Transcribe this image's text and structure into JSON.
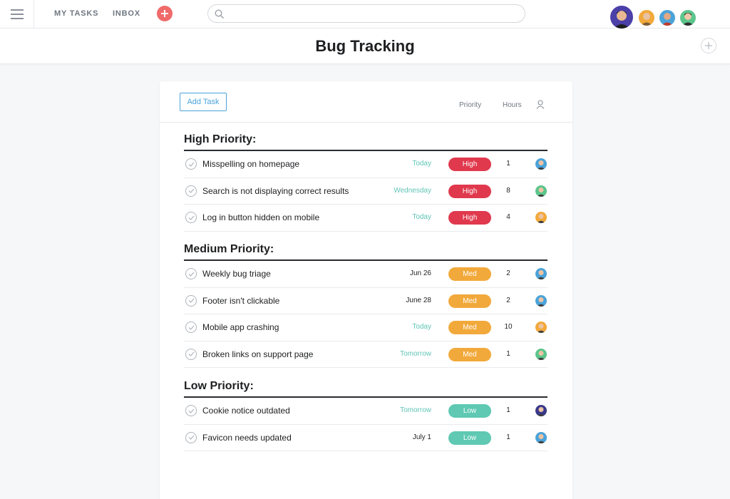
{
  "nav": {
    "my_tasks": "MY TASKS",
    "inbox": "INBOX",
    "search_placeholder": ""
  },
  "project": {
    "title": "Bug Tracking"
  },
  "toolbar": {
    "add_task_label": "Add Task",
    "priority_header": "Priority",
    "hours_header": "Hours"
  },
  "colors": {
    "high": "#e0394d",
    "med": "#f2a93b",
    "low": "#5fc9b3",
    "accent": "#4ba3d9",
    "due_teal": "#5fc4b6"
  },
  "sections": [
    {
      "title": "High Priority:",
      "tasks": [
        {
          "name": "Misspelling on homepage",
          "due": "Today",
          "priority": "High",
          "hours": "1",
          "assignee_icon": "avatar-icon"
        },
        {
          "name": "Search is not displaying correct results",
          "due": "Wednesday",
          "priority": "High",
          "hours": "8",
          "assignee_icon": "avatar-icon"
        },
        {
          "name": "Log in button hidden on mobile",
          "due": "Today",
          "priority": "High",
          "hours": "4",
          "assignee_icon": "avatar-icon"
        }
      ]
    },
    {
      "title": "Medium Priority:",
      "tasks": [
        {
          "name": "Weekly bug triage",
          "due": "Jun 26",
          "priority": "Med",
          "hours": "2",
          "assignee_icon": "avatar-icon"
        },
        {
          "name": "Footer isn't clickable",
          "due": "June 28",
          "priority": "Med",
          "hours": "2",
          "assignee_icon": "avatar-icon"
        },
        {
          "name": "Mobile app crashing",
          "due": "Today",
          "priority": "Med",
          "hours": "10",
          "assignee_icon": "avatar-icon"
        },
        {
          "name": "Broken links on support page",
          "due": "Tomorrow",
          "priority": "Med",
          "hours": "1",
          "assignee_icon": "avatar-icon"
        }
      ]
    },
    {
      "title": "Low Priority:",
      "tasks": [
        {
          "name": "Cookie notice outdated",
          "due": "Tomorrow",
          "priority": "Low",
          "hours": "1",
          "assignee_icon": "avatar-icon"
        },
        {
          "name": "Favicon needs updated",
          "due": "July 1",
          "priority": "Low",
          "hours": "1",
          "assignee_icon": "avatar-icon"
        }
      ]
    }
  ]
}
